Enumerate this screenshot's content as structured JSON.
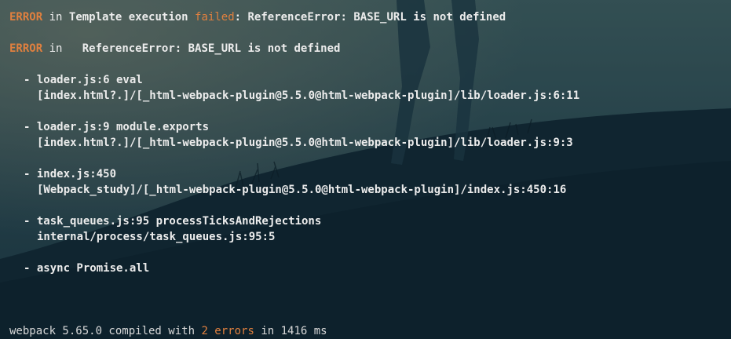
{
  "colors": {
    "background": "#142b35",
    "error": "#e0803f",
    "text": "#ececec"
  },
  "header": {
    "error_tag": "ERROR",
    "in": "in",
    "message_1": "Template execution",
    "failed_word": "failed",
    "message_2": ": ReferenceError: BASE_URL is not defined"
  },
  "second": {
    "error_tag": "ERROR",
    "in": "in",
    "message": "ReferenceError: BASE_URL is not defined"
  },
  "stack": [
    {
      "label": "- loader.js:6 eval",
      "path": "[index.html?.]/[_html-webpack-plugin@5.5.0@html-webpack-plugin]/lib/loader.js:6:11"
    },
    {
      "label": "- loader.js:9 module.exports",
      "path": "[index.html?.]/[_html-webpack-plugin@5.5.0@html-webpack-plugin]/lib/loader.js:9:3"
    },
    {
      "label": "- index.js:450",
      "path": "[Webpack_study]/[_html-webpack-plugin@5.5.0@html-webpack-plugin]/index.js:450:16"
    },
    {
      "label": "- task_queues.js:95 processTicksAndRejections",
      "path": "internal/process/task_queues.js:95:5"
    },
    {
      "label": "- async Promise.all",
      "path": ""
    }
  ],
  "footer": {
    "prefix": "webpack 5.65.0 compiled with",
    "count": "2 errors",
    "suffix": "in 1416 ms"
  }
}
